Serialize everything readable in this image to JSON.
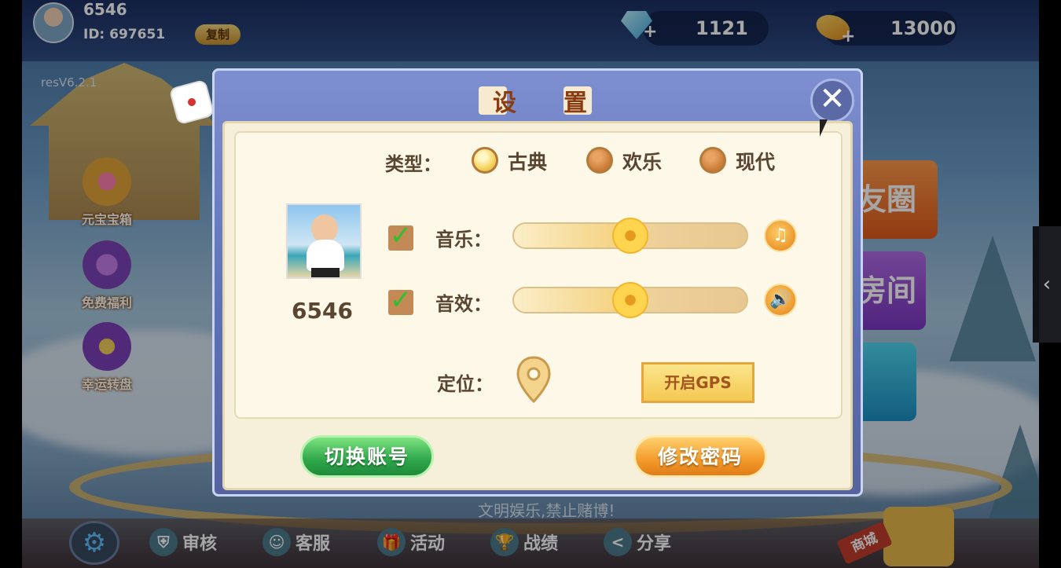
{
  "player": {
    "name": "6546",
    "id_label": "ID: 697651",
    "copy_label": "复制"
  },
  "resources": {
    "diamonds": "1121",
    "beans": "13000"
  },
  "version": "resV6.2.1",
  "side_menu": [
    {
      "label": "元宝宝箱",
      "icon": "treasure-chest-icon"
    },
    {
      "label": "免费福利",
      "icon": "gift-chest-icon"
    },
    {
      "label": "幸运转盘",
      "icon": "lucky-wheel-icon"
    }
  ],
  "right_buttons": [
    "友圈",
    "房间",
    ""
  ],
  "bottom_bar": {
    "slogan": "文明娱乐,禁止赌博!",
    "items": [
      {
        "label": "审核",
        "icon": "shield-icon"
      },
      {
        "label": "客服",
        "icon": "support-icon"
      },
      {
        "label": "活动",
        "icon": "gift-icon"
      },
      {
        "label": "战绩",
        "icon": "trophy-icon"
      },
      {
        "label": "分享",
        "icon": "share-icon"
      }
    ],
    "shop_label": "商城"
  },
  "settings": {
    "title": "设置",
    "type_label": "类型：",
    "type_options": [
      {
        "label": "古典",
        "selected": true
      },
      {
        "label": "欢乐",
        "selected": false
      },
      {
        "label": "现代",
        "selected": false
      }
    ],
    "profile_name": "6546",
    "music": {
      "label": "音乐：",
      "enabled": true,
      "level": 0.5
    },
    "sound": {
      "label": "音效：",
      "enabled": true,
      "level": 0.5
    },
    "location_label": "定位：",
    "gps_button": "开启GPS",
    "switch_account": "切换账号",
    "change_password": "修改密码"
  },
  "colors": {
    "green_button": "#2ea64a",
    "orange_button": "#f39b2b",
    "dialog_frame": "#5d6fb5",
    "paper": "#fdf8e8"
  }
}
